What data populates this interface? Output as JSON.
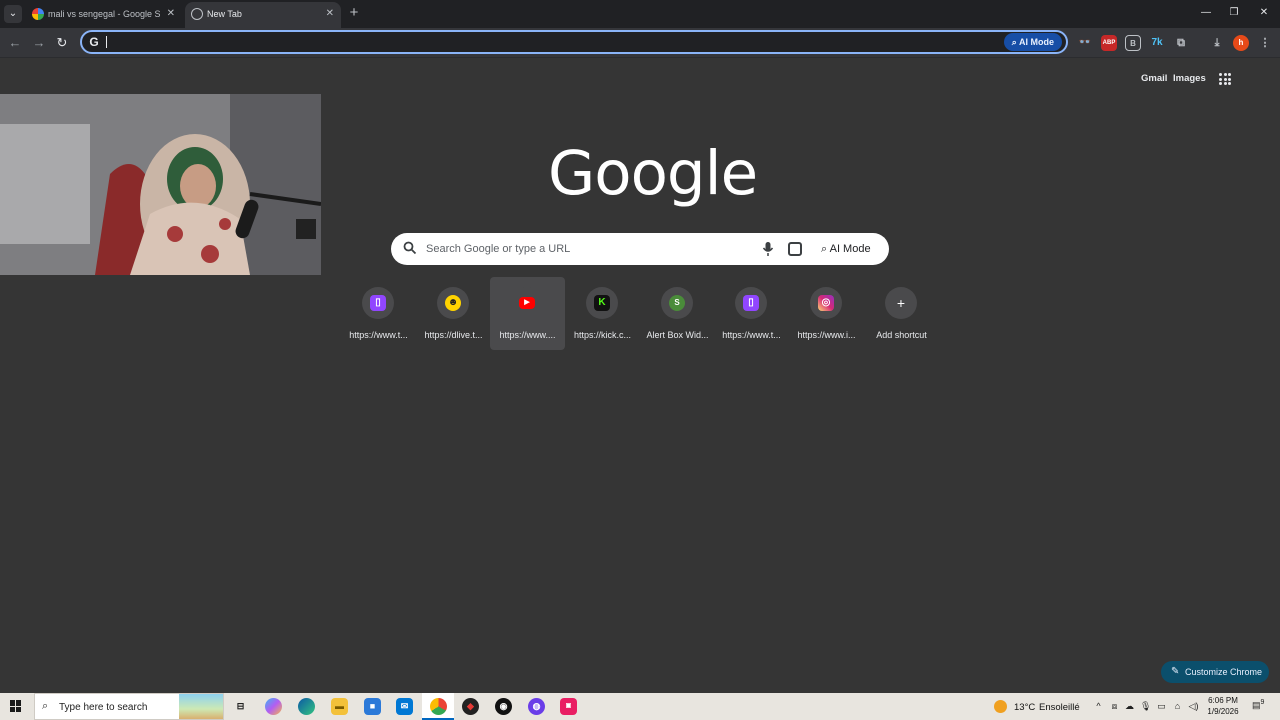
{
  "browser": {
    "tabs": [
      {
        "title": "mali vs sengegal - Google Search",
        "active": false
      },
      {
        "title": "New Tab",
        "active": true
      }
    ],
    "omnibox": {
      "value": "",
      "ai_mode_label": "AI Mode"
    },
    "extensions": [
      "incognito-glasses-icon",
      "adblock-icon",
      "square-b-icon",
      "translate-icon",
      "puzzle-icon",
      "download-icon",
      "profile-avatar"
    ],
    "profile_initial": "h"
  },
  "page": {
    "header_links": {
      "gmail": "Gmail",
      "images": "Images"
    },
    "logo_text": "Google",
    "search": {
      "placeholder": "Search Google or type a URL",
      "ai_mode_label": "AI Mode"
    },
    "shortcuts": [
      {
        "label": "https://www.t...",
        "icon": "twitch-icon",
        "color": "#9146ff"
      },
      {
        "label": "https://dlive.t...",
        "icon": "dlive-icon",
        "color": "#ffd300"
      },
      {
        "label": "https://www....",
        "icon": "youtube-icon",
        "color": "#ff0000"
      },
      {
        "label": "https://kick.c...",
        "icon": "kick-icon",
        "color": "#53fc18"
      },
      {
        "label": "Alert Box Wid...",
        "icon": "streamelements-icon",
        "color": "#4a8c3a"
      },
      {
        "label": "https://www.t...",
        "icon": "twitch-icon",
        "color": "#9146ff"
      },
      {
        "label": "https://www.i...",
        "icon": "instagram-icon",
        "color": "#e1306c"
      },
      {
        "label": "Add shortcut",
        "icon": "plus-icon",
        "color": "#4a4a4c"
      }
    ],
    "customize_label": "Customize Chrome"
  },
  "taskbar": {
    "search_placeholder": "Type here to search",
    "weather": {
      "temp": "13°C",
      "condition": "Ensoleillé"
    },
    "time": "6:06 PM",
    "date": "1/9/2026",
    "notification_count": "9"
  }
}
